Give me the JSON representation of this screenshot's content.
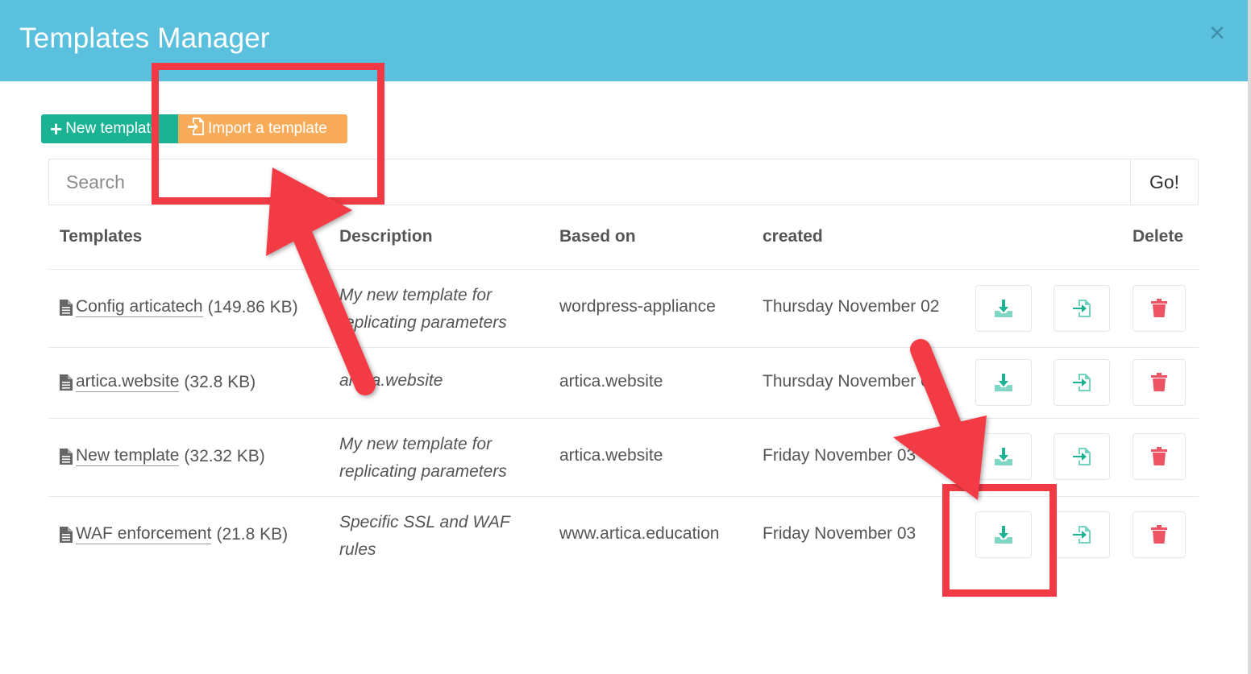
{
  "modal": {
    "title": "Templates Manager",
    "close_glyph": "×"
  },
  "toolbar": {
    "new_label": "New template",
    "import_label": "Import a template"
  },
  "search": {
    "placeholder": "Search",
    "go_label": "Go!"
  },
  "table": {
    "headers": {
      "templates": "Templates",
      "description": "Description",
      "based_on": "Based on",
      "created": "created",
      "delete": "Delete"
    },
    "rows": [
      {
        "name": "Config articatech",
        "size": "(149.86 KB)",
        "description": "My new template for replicating parameters",
        "based_on": "wordpress-appliance",
        "created": "Thursday November 02"
      },
      {
        "name": "artica.website",
        "size": "(32.8 KB)",
        "description": "artica.website",
        "based_on": "artica.website",
        "created": "Thursday November 02"
      },
      {
        "name": "New template",
        "size": "(32.32 KB)",
        "description": "My new template for replicating parameters",
        "based_on": "artica.website",
        "created": "Friday November 03"
      },
      {
        "name": "WAF enforcement",
        "size": "(21.8 KB)",
        "description": "Specific SSL and WAF rules",
        "based_on": "www.artica.education",
        "created": "Friday November 03"
      }
    ]
  },
  "icons": [
    "file-icon",
    "download-icon",
    "import-icon",
    "trash-icon",
    "plus-icon",
    "close-icon"
  ],
  "colors": {
    "header": "#5bc0de",
    "new_button": "#1ab394",
    "import_button": "#f8ac59",
    "action_icon": "#1ab394",
    "delete_icon": "#ed5565",
    "annotation": "#f23a45"
  }
}
